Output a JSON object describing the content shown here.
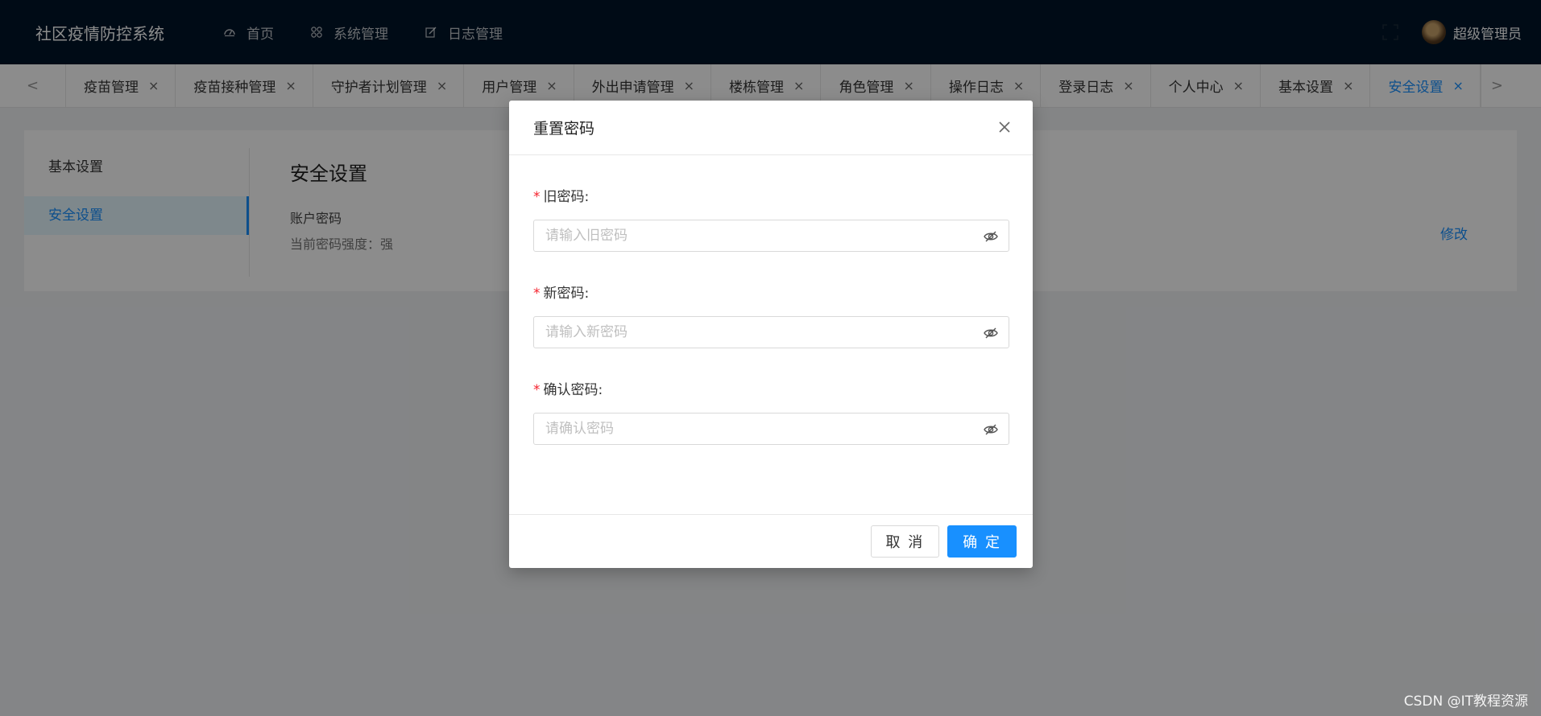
{
  "header": {
    "brand": "社区疫情防控系统",
    "nav": [
      {
        "label": "首页",
        "icon": "dashboard-icon"
      },
      {
        "label": "系统管理",
        "icon": "appstore-icon"
      },
      {
        "label": "日志管理",
        "icon": "edit-icon"
      }
    ],
    "user_name": "超级管理员"
  },
  "tabs": {
    "items": [
      {
        "label": "疫苗管理"
      },
      {
        "label": "疫苗接种管理"
      },
      {
        "label": "守护者计划管理"
      },
      {
        "label": "用户管理"
      },
      {
        "label": "外出申请管理"
      },
      {
        "label": "楼栋管理"
      },
      {
        "label": "角色管理"
      },
      {
        "label": "操作日志"
      },
      {
        "label": "登录日志"
      },
      {
        "label": "个人中心"
      },
      {
        "label": "基本设置"
      },
      {
        "label": "安全设置",
        "active": true
      }
    ],
    "close_glyph": "×",
    "prev_glyph": "<",
    "next_glyph": ">"
  },
  "settings": {
    "menu": [
      {
        "label": "基本设置"
      },
      {
        "label": "安全设置",
        "active": true
      }
    ],
    "title": "安全设置",
    "account_label": "账户密码",
    "strength_text": "当前密码强度：强",
    "modify_link": "修改"
  },
  "modal": {
    "title": "重置密码",
    "fields": [
      {
        "label": "旧密码:",
        "placeholder": "请输入旧密码"
      },
      {
        "label": "新密码:",
        "placeholder": "请输入新密码"
      },
      {
        "label": "确认密码:",
        "placeholder": "请确认密码"
      }
    ],
    "required_mark": "*",
    "cancel_label": "取 消",
    "ok_label": "确 定"
  },
  "watermark": "CSDN @IT教程资源",
  "colors": {
    "header_bg": "#001529",
    "primary": "#1890ff",
    "required": "#f5222d"
  }
}
